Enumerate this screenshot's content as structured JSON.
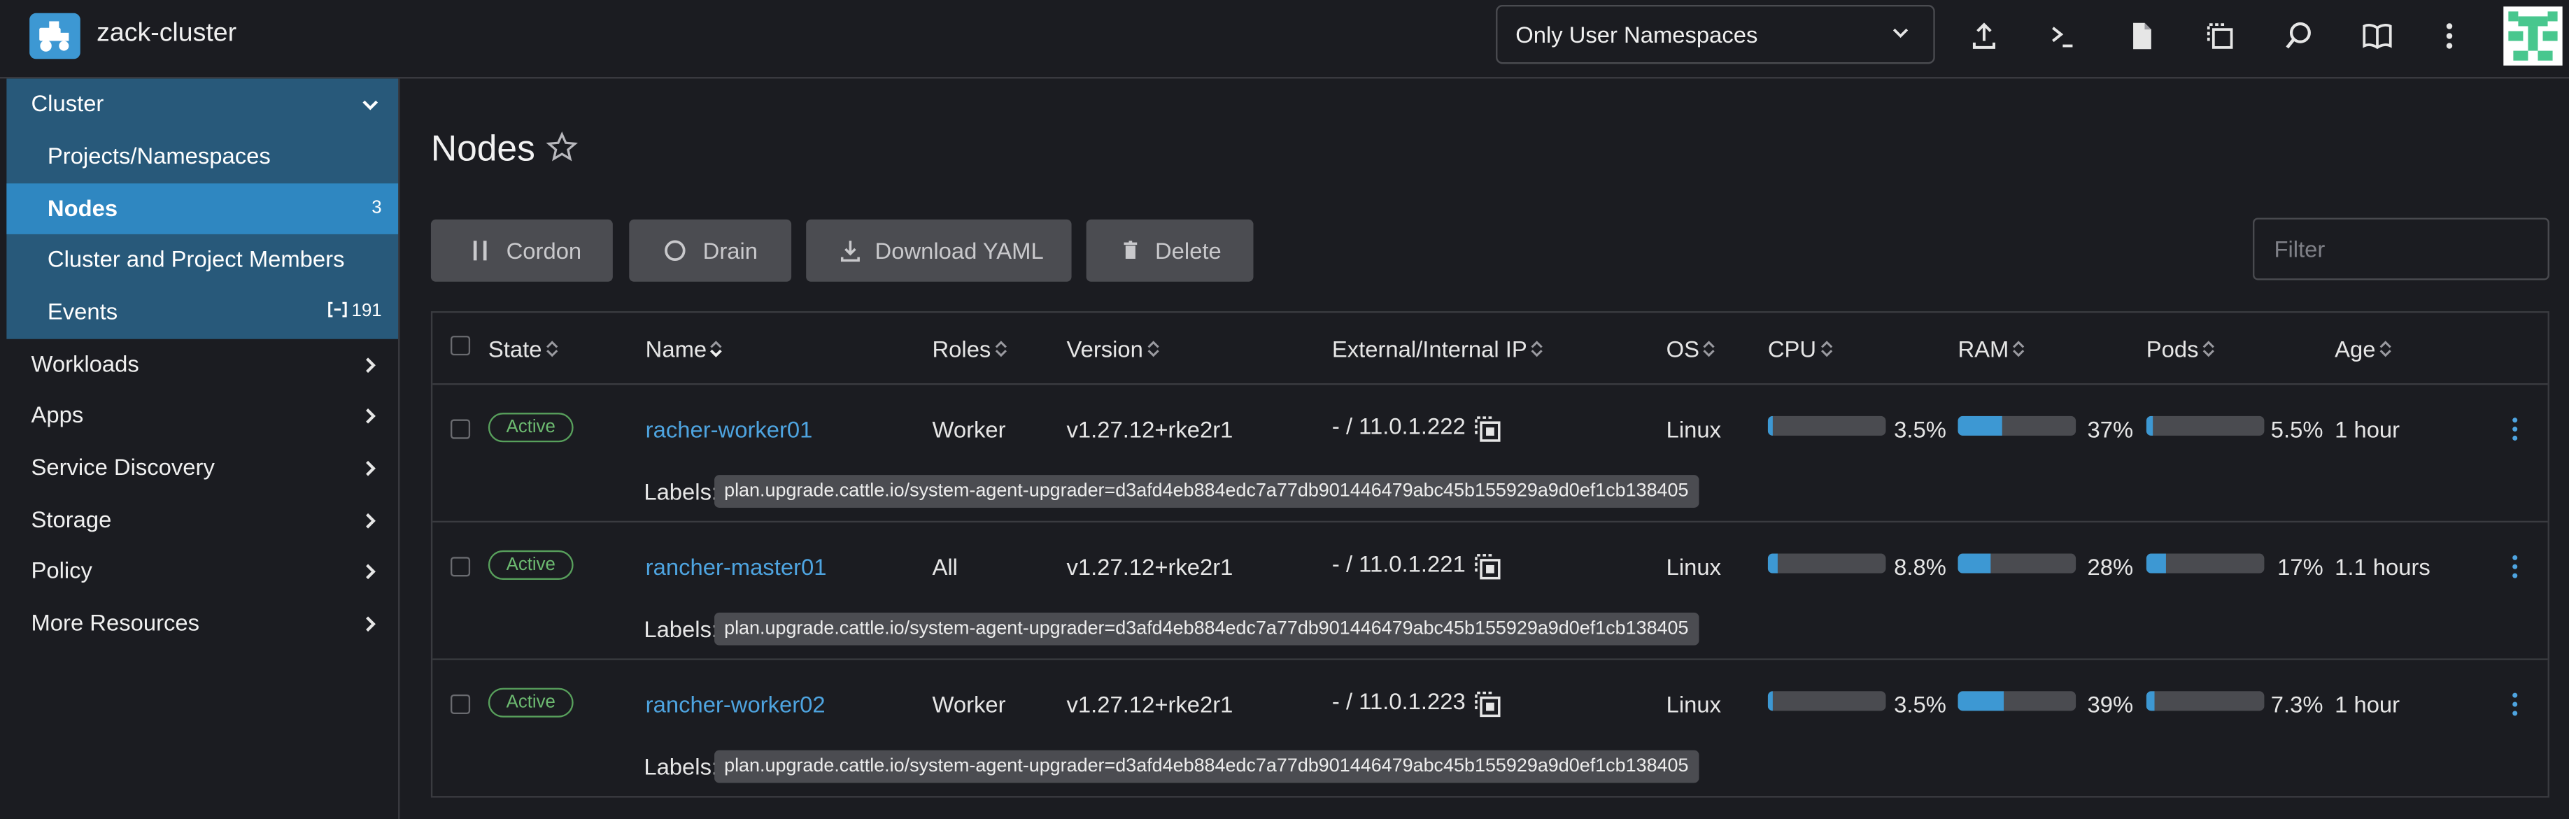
{
  "header": {
    "cluster_name": "zack-cluster",
    "namespace_filter": "Only User Namespaces",
    "icons": [
      "upload-icon",
      "kubectl-shell-icon",
      "kubeconfig-file-icon",
      "copy-kubeconfig-icon",
      "search-icon",
      "docs-book-icon",
      "more-vertical-icon"
    ]
  },
  "sidebar": {
    "group_label": "Cluster",
    "group_items": [
      {
        "label": "Projects/Namespaces",
        "count": ""
      },
      {
        "label": "Nodes",
        "count": "3"
      },
      {
        "label": "Cluster and Project Members",
        "count": ""
      },
      {
        "label": "Events",
        "count": "191"
      }
    ],
    "nav_items": [
      "Workloads",
      "Apps",
      "Service Discovery",
      "Storage",
      "Policy",
      "More Resources"
    ]
  },
  "page": {
    "title": "Nodes",
    "buttons": {
      "cordon": "Cordon",
      "drain": "Drain",
      "download": "Download YAML",
      "delete": "Delete"
    },
    "filter_placeholder": "Filter"
  },
  "table": {
    "columns": [
      "State",
      "Name",
      "Roles",
      "Version",
      "External/Internal IP",
      "OS",
      "CPU",
      "RAM",
      "Pods",
      "Age"
    ],
    "labels_key": "Labels:",
    "rows": [
      {
        "state": "Active",
        "name": "racher-worker01",
        "roles": "Worker",
        "version": "v1.27.12+rke2r1",
        "ip": "- / 11.0.1.222",
        "os": "Linux",
        "cpu": "3.5%",
        "cpu_frac": 0.035,
        "ram": "37%",
        "ram_frac": 0.37,
        "pods": "5.5%",
        "pods_frac": 0.055,
        "age": "1 hour",
        "label": "plan.upgrade.cattle.io/system-agent-upgrader=d3afd4eb884edc7a77db901446479abc45b155929a9d0ef1cb138405"
      },
      {
        "state": "Active",
        "name": "rancher-master01",
        "roles": "All",
        "version": "v1.27.12+rke2r1",
        "ip": "- / 11.0.1.221",
        "os": "Linux",
        "cpu": "8.8%",
        "cpu_frac": 0.088,
        "ram": "28%",
        "ram_frac": 0.28,
        "pods": "17%",
        "pods_frac": 0.17,
        "age": "1.1 hours",
        "label": "plan.upgrade.cattle.io/system-agent-upgrader=d3afd4eb884edc7a77db901446479abc45b155929a9d0ef1cb138405"
      },
      {
        "state": "Active",
        "name": "rancher-worker02",
        "roles": "Worker",
        "version": "v1.27.12+rke2r1",
        "ip": "- / 11.0.1.223",
        "os": "Linux",
        "cpu": "3.5%",
        "cpu_frac": 0.035,
        "ram": "39%",
        "ram_frac": 0.39,
        "pods": "7.3%",
        "pods_frac": 0.073,
        "age": "1 hour",
        "label": "plan.upgrade.cattle.io/system-agent-upgrader=d3afd4eb884edc7a77db901446479abc45b155929a9d0ef1cb138405"
      }
    ]
  },
  "colors": {
    "accent": "#3d98d3",
    "active_badge": "#6dbb71",
    "link": "#4ea4e0",
    "sidebar_group": "#28597a",
    "sidebar_active": "#2f87c1"
  }
}
